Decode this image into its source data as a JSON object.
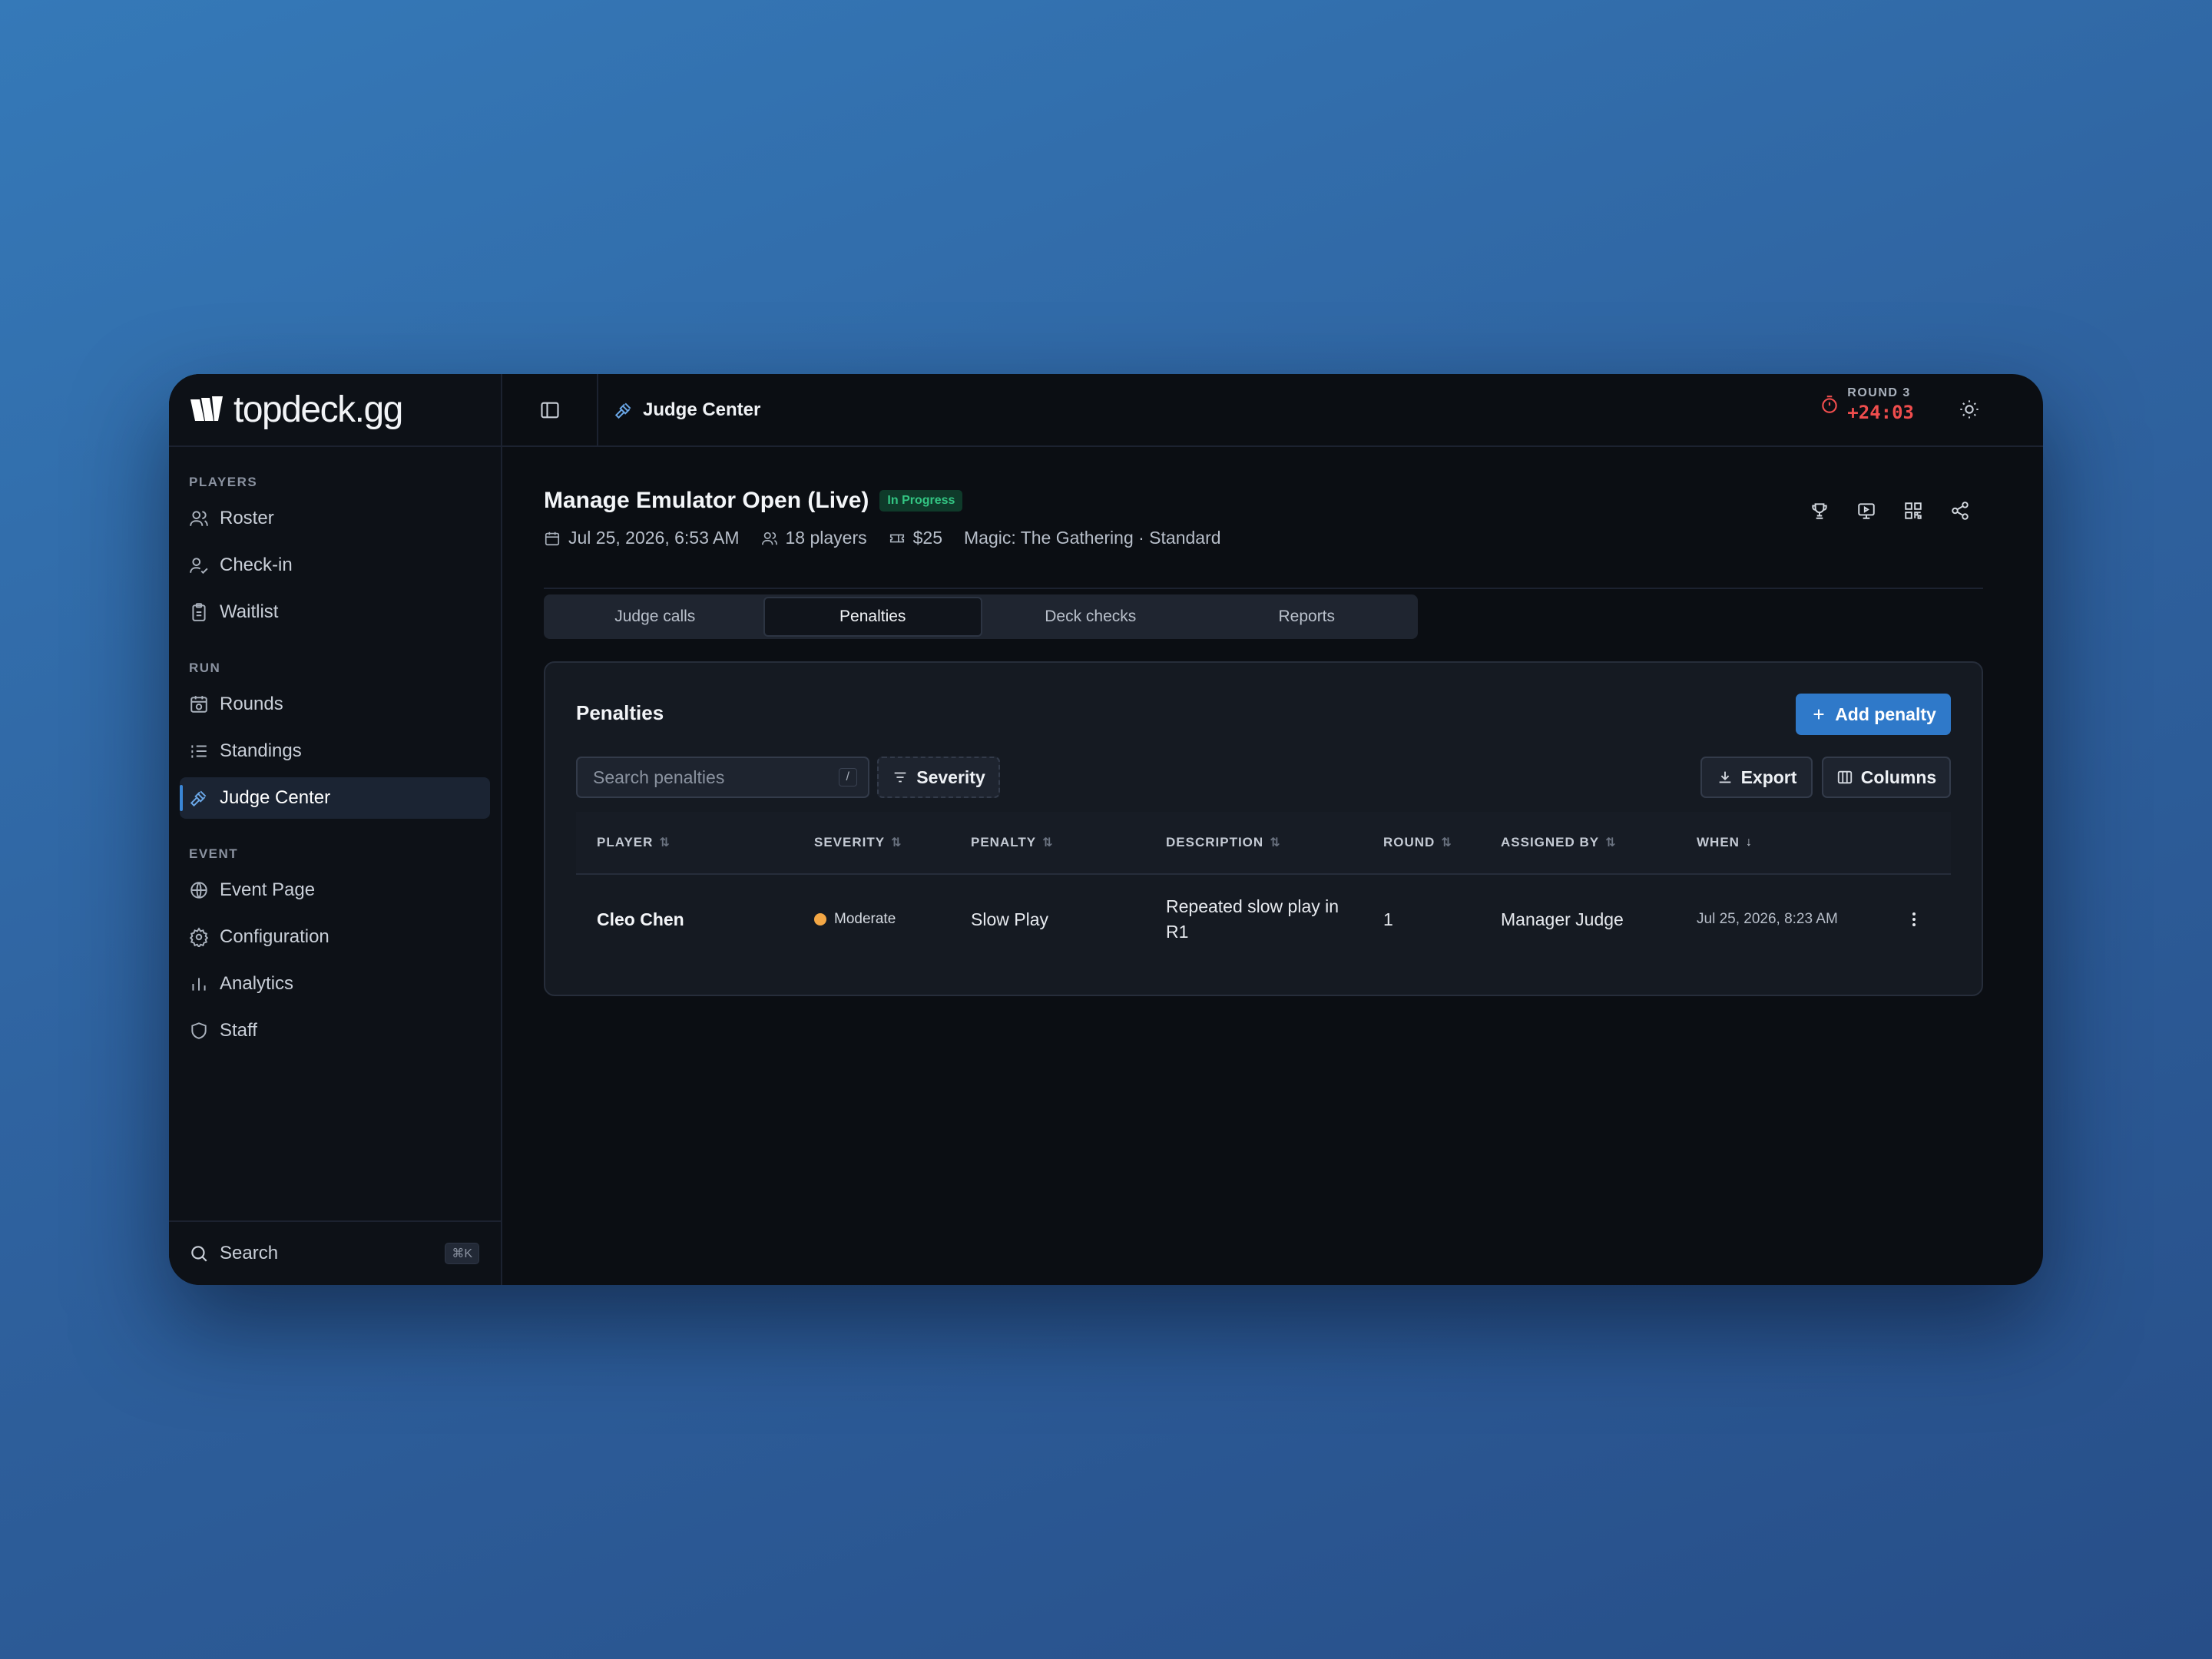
{
  "brand": {
    "name": "topdeck.gg"
  },
  "sidebar": {
    "sections": [
      {
        "heading": "PLAYERS",
        "items": [
          {
            "label": "Roster",
            "icon": "users-icon"
          },
          {
            "label": "Check-in",
            "icon": "user-check-icon"
          },
          {
            "label": "Waitlist",
            "icon": "clipboard-icon"
          }
        ]
      },
      {
        "heading": "RUN",
        "items": [
          {
            "label": "Rounds",
            "icon": "calendar-clock-icon"
          },
          {
            "label": "Standings",
            "icon": "list-ordered-icon"
          },
          {
            "label": "Judge Center",
            "icon": "gavel-icon",
            "active": true
          }
        ]
      },
      {
        "heading": "EVENT",
        "items": [
          {
            "label": "Event Page",
            "icon": "globe-icon"
          },
          {
            "label": "Configuration",
            "icon": "gear-icon"
          },
          {
            "label": "Analytics",
            "icon": "bar-chart-icon"
          },
          {
            "label": "Staff",
            "icon": "shield-icon"
          }
        ]
      }
    ],
    "footer": {
      "search_label": "Search",
      "shortcut": "⌘K"
    }
  },
  "topbar": {
    "title": "Judge Center",
    "round_label": "ROUND 3",
    "round_time": "+24:03"
  },
  "event": {
    "title": "Manage Emulator Open (Live)",
    "status": "In Progress",
    "date": "Jul 25, 2026, 6:53 AM",
    "players": "18 players",
    "fee": "$25",
    "format": "Magic: The Gathering · Standard"
  },
  "tabs": [
    {
      "label": "Judge calls"
    },
    {
      "label": "Penalties",
      "active": true
    },
    {
      "label": "Deck checks"
    },
    {
      "label": "Reports"
    }
  ],
  "panel": {
    "title": "Penalties",
    "add_label": "Add penalty",
    "search_placeholder": "Search penalties",
    "search_shortcut": "/",
    "severity_filter": "Severity",
    "export_label": "Export",
    "columns_label": "Columns"
  },
  "table": {
    "columns": [
      "PLAYER",
      "SEVERITY",
      "PENALTY",
      "DESCRIPTION",
      "ROUND",
      "ASSIGNED BY",
      "WHEN"
    ],
    "sort_icons": [
      "⇅",
      "⇅",
      "⇅",
      "⇅",
      "⇅",
      "⇅",
      "↓"
    ],
    "rows": [
      {
        "player": "Cleo Chen",
        "severity": "Moderate",
        "penalty": "Slow Play",
        "description": "Repeated slow play in R1",
        "round": "1",
        "assigned_by": "Manager Judge",
        "when": "Jul 25, 2026, 8:23 AM"
      }
    ]
  },
  "colors": {
    "accent": "#2f79c9",
    "status_green": "#33c583",
    "timer_red": "#ef4d4d",
    "severity_moderate": "#f3a745"
  }
}
